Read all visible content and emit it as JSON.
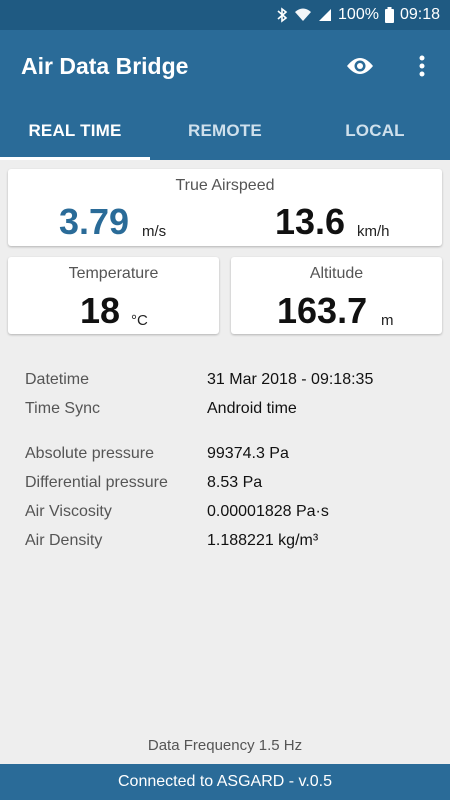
{
  "status_bar": {
    "battery": "100%",
    "time": "09:18",
    "icons": [
      "bluetooth-icon",
      "wifi-icon",
      "signal-icon",
      "battery-icon"
    ]
  },
  "app_bar": {
    "title": "Air Data Bridge",
    "actions": [
      "eye-icon",
      "more-vert-icon"
    ]
  },
  "tabs": [
    {
      "label": "REAL TIME",
      "active": true
    },
    {
      "label": "REMOTE",
      "active": false
    },
    {
      "label": "LOCAL",
      "active": false
    }
  ],
  "airspeed": {
    "label": "True Airspeed",
    "ms_value": "3.79",
    "ms_unit": "m/s",
    "kmh_value": "13.6",
    "kmh_unit": "km/h"
  },
  "temperature": {
    "label": "Temperature",
    "value": "18",
    "unit": "°C"
  },
  "altitude": {
    "label": "Altitude",
    "value": "163.7",
    "unit": "m"
  },
  "info": {
    "datetime_label": "Datetime",
    "datetime_value": "31 Mar 2018 - 09:18:35",
    "timesync_label": "Time Sync",
    "timesync_value": "Android time",
    "abs_pressure_label": "Absolute pressure",
    "abs_pressure_value": "99374.3  Pa",
    "diff_pressure_label": "Differential pressure",
    "diff_pressure_value": "8.53  Pa",
    "viscosity_label": "Air Viscosity",
    "viscosity_value": "0.00001828  Pa·s",
    "density_label": "Air Density",
    "density_value": "1.188221  kg/m³"
  },
  "footer": {
    "frequency": "Data Frequency 1.5 Hz",
    "connection": "Connected to ASGARD - v.0.5"
  },
  "colors": {
    "primary": "#2a6b98",
    "status_bar": "#1f5a82",
    "accent_value": "#2a6b98"
  }
}
